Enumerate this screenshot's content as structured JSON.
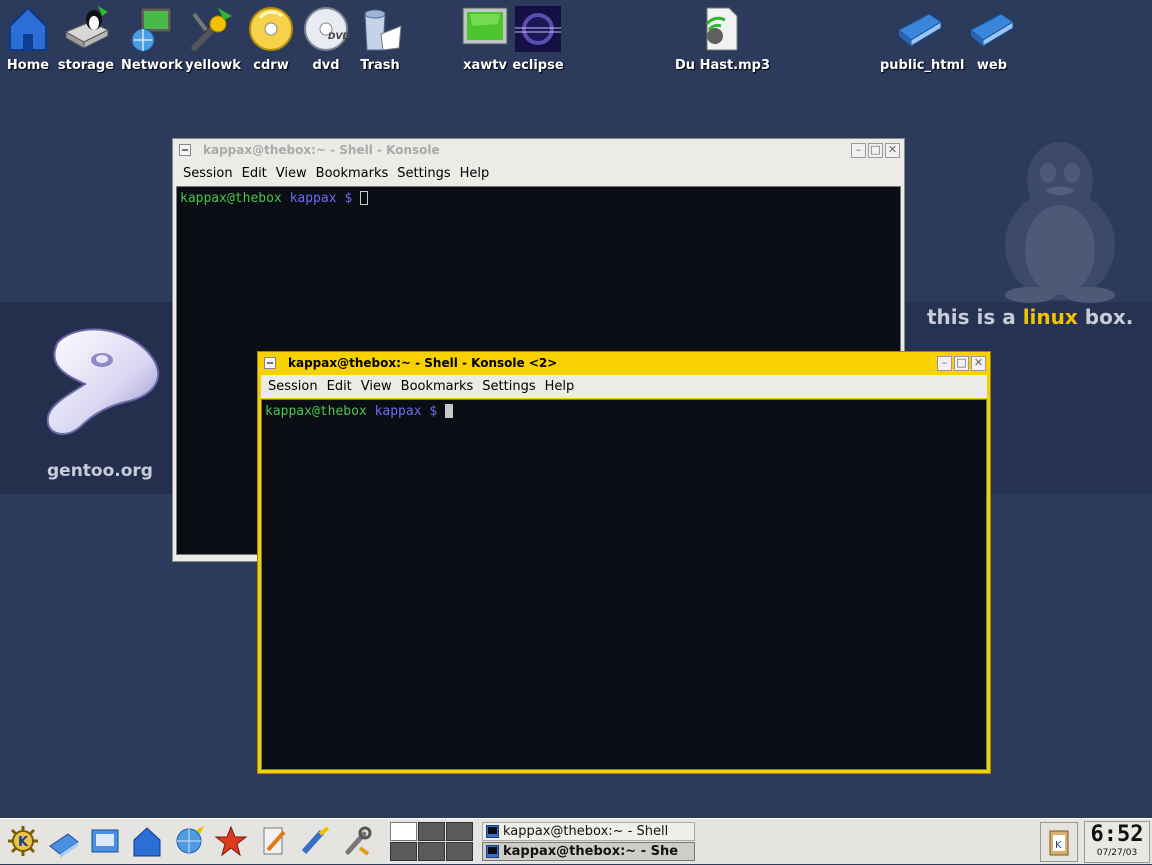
{
  "desktop": {
    "icons": [
      {
        "label": "Home"
      },
      {
        "label": "storage"
      },
      {
        "label": "Network"
      },
      {
        "label": "yellowk"
      },
      {
        "label": "cdrw"
      },
      {
        "label": "dvd"
      },
      {
        "label": "Trash"
      },
      {
        "label": "xawtv"
      },
      {
        "label": "eclipse"
      },
      {
        "label": "Du Hast.mp3"
      },
      {
        "label": "public_html"
      },
      {
        "label": "web"
      }
    ],
    "wallpaper": {
      "left_text": "gentoo.org",
      "right_text_1": "this is a ",
      "right_text_2": "linux",
      "right_text_3": " box."
    }
  },
  "windows": [
    {
      "title": "kappax@thebox:~ - Shell - Konsole",
      "menu": [
        "Session",
        "Edit",
        "View",
        "Bookmarks",
        "Settings",
        "Help"
      ],
      "prompt_user": "kappax@thebox",
      "prompt_dir": "kappax",
      "prompt_symbol": "$"
    },
    {
      "title": "kappax@thebox:~ - Shell - Konsole <2>",
      "menu": [
        "Session",
        "Edit",
        "View",
        "Bookmarks",
        "Settings",
        "Help"
      ],
      "prompt_user": "kappax@thebox",
      "prompt_dir": "kappax",
      "prompt_symbol": "$"
    }
  ],
  "taskbar": {
    "tasks": [
      {
        "label": "kappax@thebox:~ - Shell"
      },
      {
        "label": "kappax@thebox:~ - She"
      }
    ],
    "clock": {
      "time": "6:52",
      "date": "07/27/03"
    }
  },
  "colors": {
    "desktop": "#2c3a5c",
    "active_title": "#f7d200",
    "prompt_user": "#49c549",
    "prompt_dir": "#6b6bf0"
  }
}
